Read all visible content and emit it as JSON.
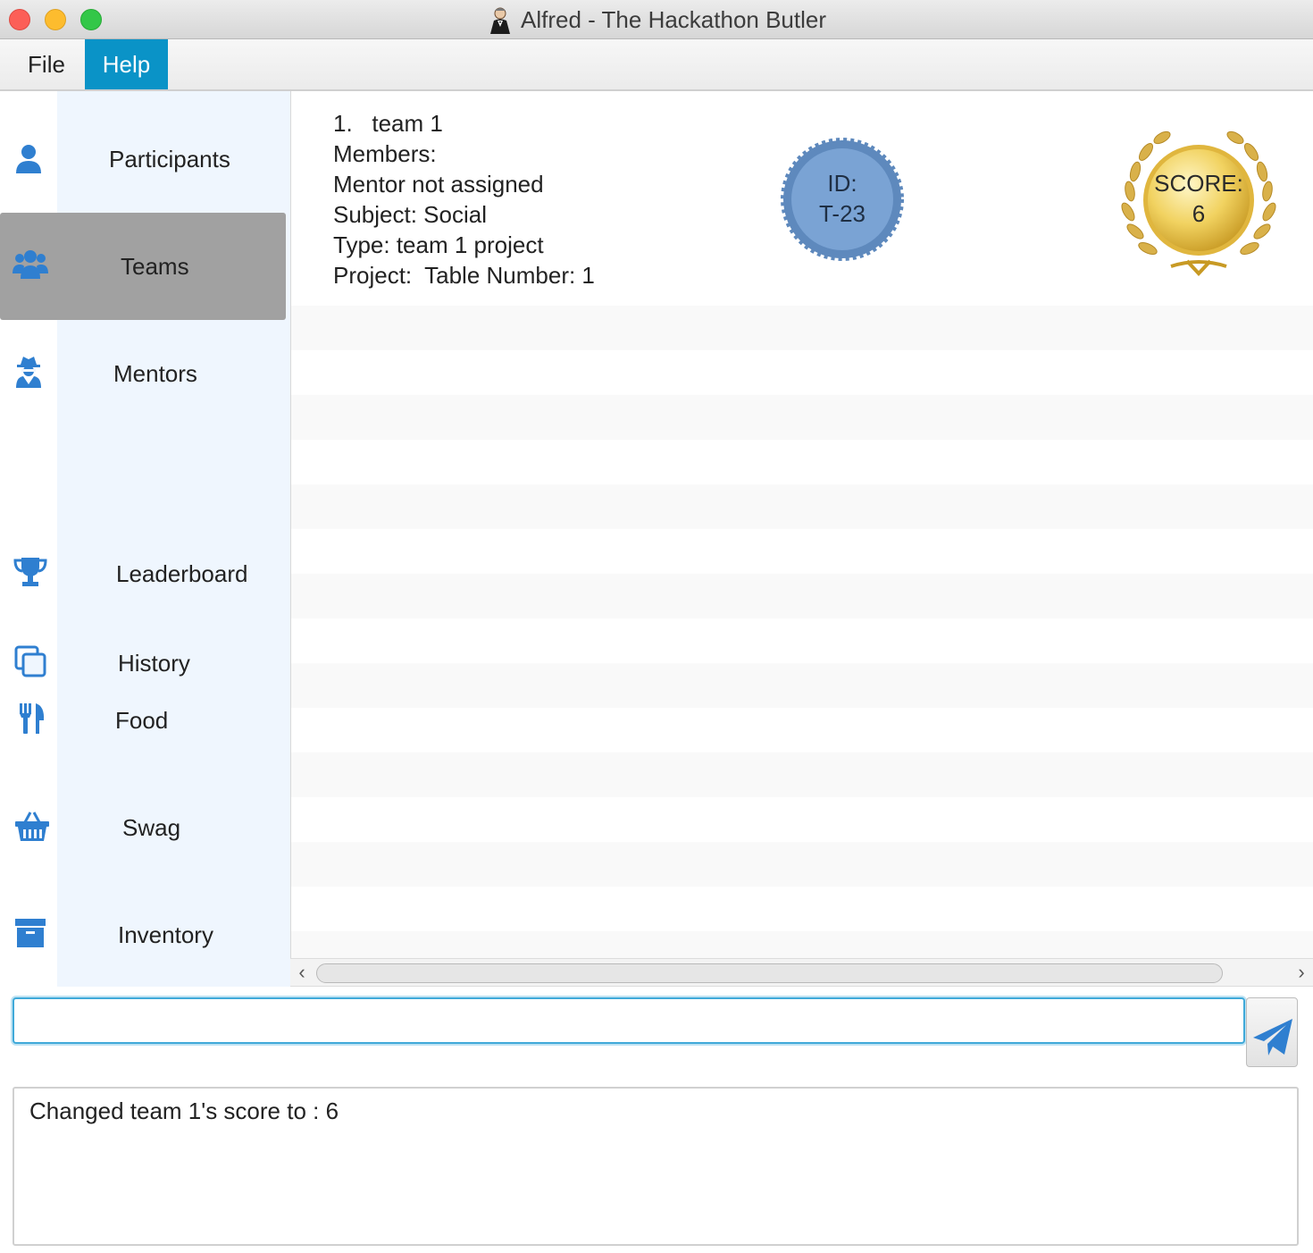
{
  "window": {
    "title": "Alfred - The Hackathon Butler",
    "icon": "butler-icon"
  },
  "menu": {
    "items": [
      {
        "label": "File",
        "active": false
      },
      {
        "label": "Help",
        "active": true
      }
    ]
  },
  "sidebar": {
    "items": [
      {
        "label": "Participants",
        "icon": "user-icon",
        "active": false
      },
      {
        "label": "Teams",
        "icon": "users-icon",
        "active": true
      },
      {
        "label": "Mentors",
        "icon": "user-secret-icon",
        "active": false
      },
      {
        "label": "Leaderboard",
        "icon": "trophy-icon",
        "active": false
      },
      {
        "label": "History",
        "icon": "copy-icon",
        "active": false
      },
      {
        "label": "Food",
        "icon": "utensils-icon",
        "active": false
      },
      {
        "label": "Swag",
        "icon": "shopping-basket-icon",
        "active": false
      },
      {
        "label": "Inventory",
        "icon": "archive-icon",
        "active": false
      }
    ]
  },
  "team_card": {
    "index": "1.",
    "name": "team 1",
    "members_label": "Members:",
    "mentor": "Mentor not assigned",
    "subject": "Subject: Social",
    "type": "Type: team 1 project",
    "project": "Project:  Table Number: 1",
    "id_label": "ID:",
    "id_value": "T-23",
    "score_label": "SCORE:",
    "score_value": "6"
  },
  "command": {
    "value": "",
    "placeholder": "",
    "send_icon": "paper-plane-icon"
  },
  "result": {
    "text": "Changed team 1's score to : 6"
  },
  "colors": {
    "accent": "#0a93c7",
    "icon_blue": "#2f7fd0",
    "sidebar_bg": "#eff6fe",
    "active_item": "#a1a1a1",
    "id_badge": "#7aa3d4",
    "score_gold": "#e8c447"
  }
}
